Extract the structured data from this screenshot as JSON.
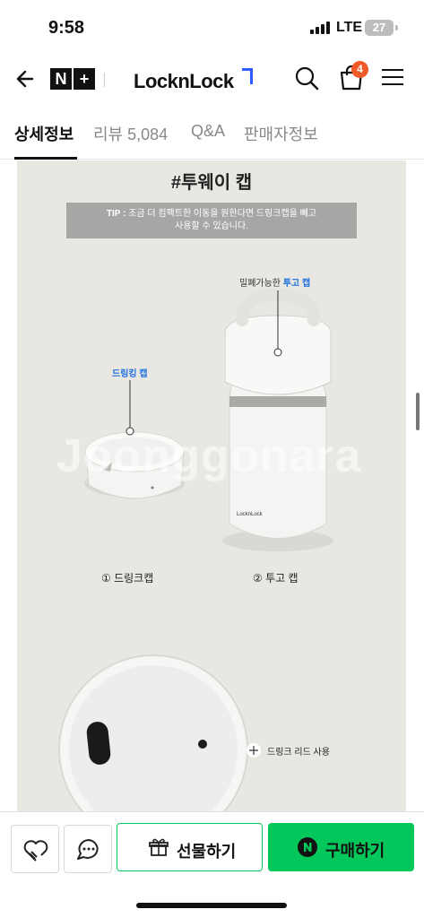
{
  "status_bar": {
    "time": "9:58",
    "network": "LTE",
    "battery": "27"
  },
  "header": {
    "badge_left": "N",
    "badge_right": "+",
    "brand": "LocknLock",
    "cart_count": "4",
    "icons": [
      "back-arrow-icon",
      "search-icon",
      "shopping-bag-icon",
      "hamburger-menu-icon"
    ],
    "accent_color": "#2e5bff"
  },
  "tabs": [
    {
      "label": "상세정보",
      "active": true
    },
    {
      "label": "리뷰 5,084",
      "active": false
    },
    {
      "label": "Q&A",
      "active": false
    },
    {
      "label": "판매자정보",
      "active": false
    }
  ],
  "detail": {
    "title": "#투웨이 캡",
    "tip_prefix": "TIP :",
    "tip_line1": "조금 더 컴팩트한 이동을 원한다면 드링크캡을 빼고",
    "tip_line2": "사용할 수 있습니다.",
    "togo_label_plain": "밀폐가능한",
    "togo_label_accent": "투고 캡",
    "drink_label": "드링킹 캡",
    "caption_left": "① 드링크캡",
    "caption_right": "② 투고 캡",
    "product_print": "LocknLock",
    "lid_label": "드링크 리드 사용",
    "watermark": "Joonggonara",
    "accent_color": "#1f6fe0"
  },
  "bottom_bar": {
    "gift_label": "선물하기",
    "buy_label": "구매하기",
    "buy_color": "#03c75a",
    "icons": [
      "heart-plus-icon",
      "chat-bubble-icon",
      "gift-icon",
      "naver-n-icon"
    ]
  }
}
